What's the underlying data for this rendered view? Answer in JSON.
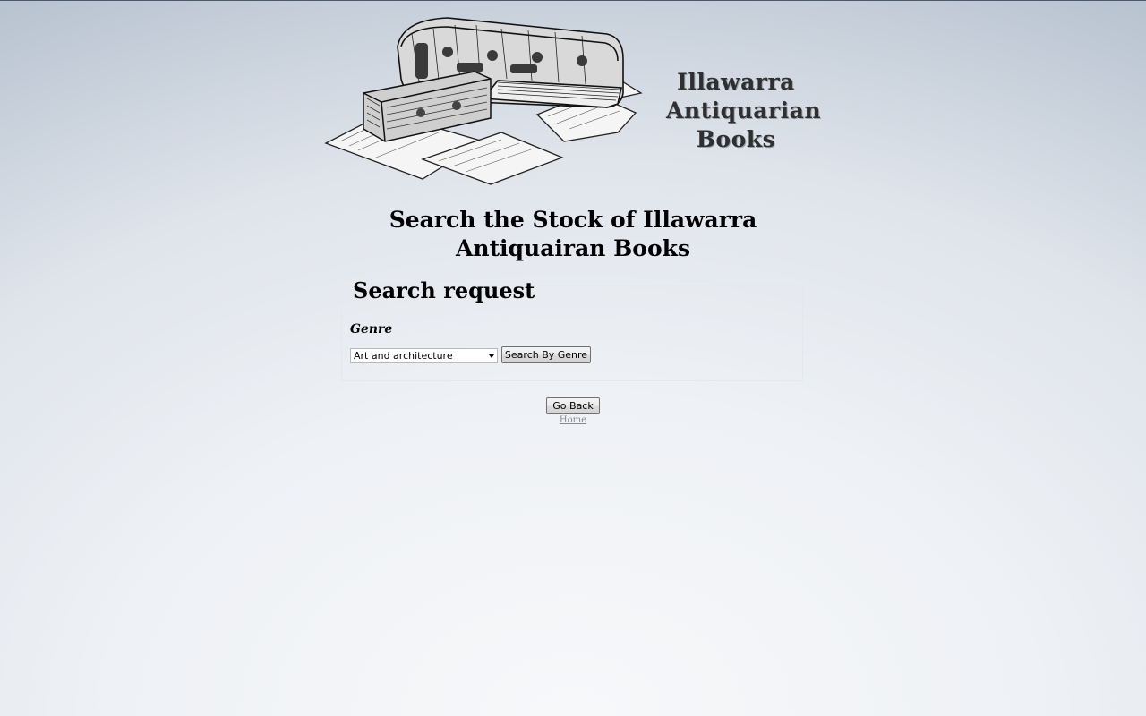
{
  "header": {
    "shop_name_lines": [
      "Illawarra",
      "Antiquarian",
      "Books"
    ],
    "page_title": "Search the Stock of Illawarra Antiquairan Books"
  },
  "search_panel": {
    "heading": "Search request",
    "genre_label": "Genre",
    "genre_selected": "Art and architecture",
    "search_button": "Search By Genre"
  },
  "footer": {
    "back_button": "Go Back",
    "home_link": "Home"
  },
  "icons": {
    "book_illustration": "antique-books-illustration-icon",
    "select_arrow": "chevron-down-icon"
  }
}
